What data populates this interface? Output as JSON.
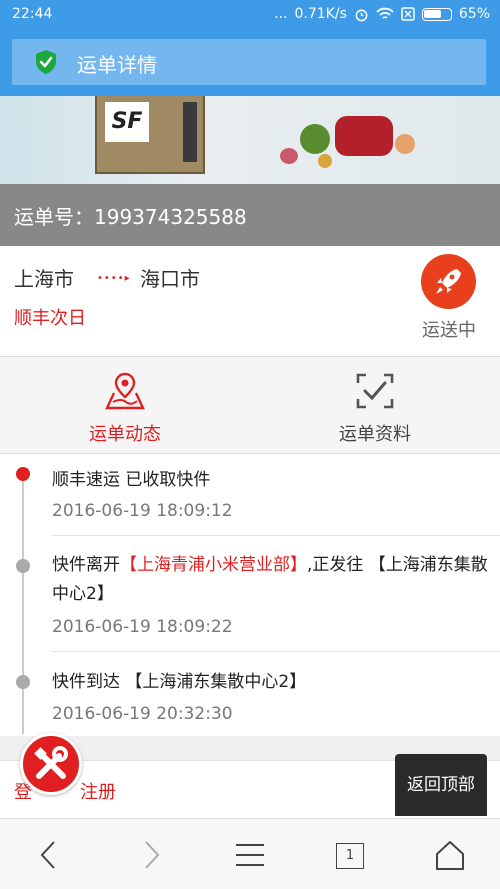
{
  "status_bar": {
    "time": "22:44",
    "dots": "...",
    "speed": "0.71K/s",
    "battery": "65%"
  },
  "header": {
    "title": "运单详情",
    "icon": "shield-check-icon"
  },
  "banner": {
    "logo": "SF"
  },
  "order": {
    "label": "运单号：",
    "number": "199374325588"
  },
  "route": {
    "from": "上海市",
    "arrow": "••••▸",
    "to": "海口市",
    "service": "顺丰次日",
    "status": "运送中",
    "status_icon": "rocket-icon"
  },
  "tabs": [
    {
      "label": "运单动态",
      "icon": "map-pin-icon",
      "active": true
    },
    {
      "label": "运单资料",
      "icon": "checklist-icon",
      "active": false
    }
  ],
  "timeline": [
    {
      "text_pre": "顺丰速运 已收取快件",
      "text_hl": "",
      "text_post": "",
      "time": "2016-06-19 18:09:12",
      "current": true
    },
    {
      "text_pre": "快件离开",
      "text_hl": "【上海青浦小米营业部】",
      "text_post": ",正发往 【上海浦东集散中心2】",
      "time": "2016-06-19 18:09:22",
      "current": false
    },
    {
      "text_pre": "快件到达 【上海浦东集散中心2】",
      "text_hl": "",
      "text_post": "",
      "time": "2016-06-19 20:32:30",
      "current": false
    }
  ],
  "footer": {
    "login": "登",
    "register": "注册"
  },
  "back_to_top": "返回顶部",
  "browser": {
    "tab_count": "1"
  },
  "colors": {
    "accent_blue": "#3d9be8",
    "accent_red": "#e02020"
  }
}
